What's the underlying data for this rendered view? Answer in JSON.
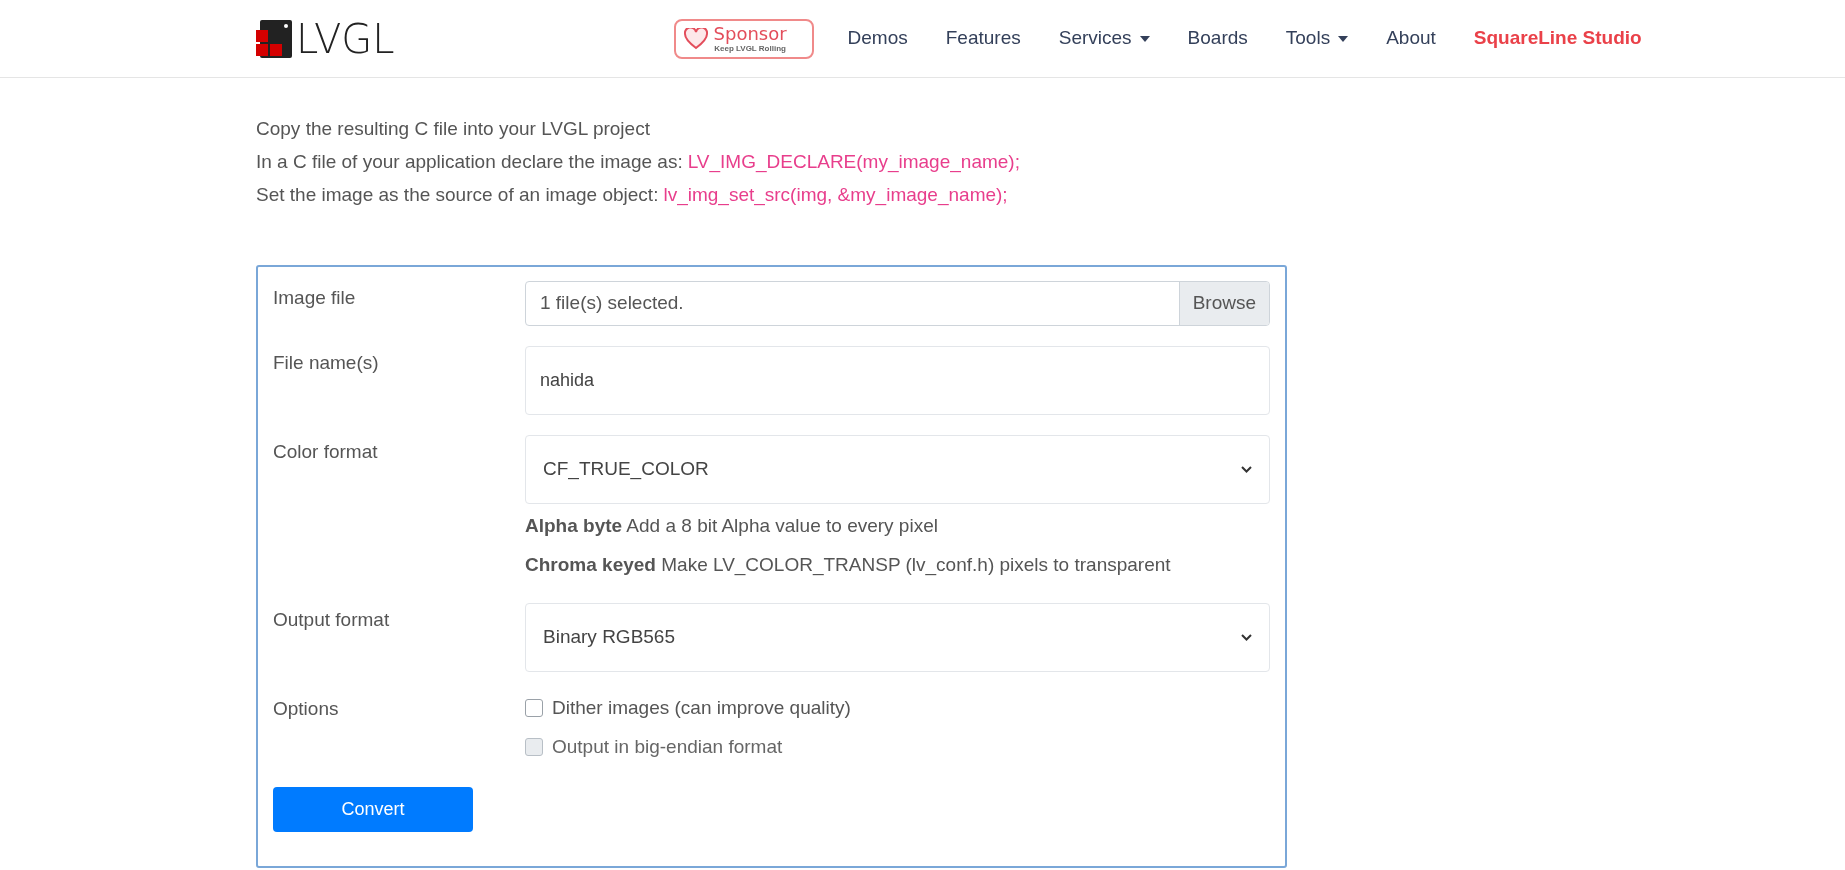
{
  "header": {
    "logo": "LVGL",
    "sponsor": {
      "title": "Sponsor",
      "subtitle": "Keep LVGL Rolling"
    },
    "nav": [
      {
        "label": "Demos",
        "dropdown": false,
        "highlight": false
      },
      {
        "label": "Features",
        "dropdown": false,
        "highlight": false
      },
      {
        "label": "Services",
        "dropdown": true,
        "highlight": false
      },
      {
        "label": "Boards",
        "dropdown": false,
        "highlight": false
      },
      {
        "label": "Tools",
        "dropdown": true,
        "highlight": false
      },
      {
        "label": "About",
        "dropdown": false,
        "highlight": false
      },
      {
        "label": "SquareLine Studio",
        "dropdown": false,
        "highlight": true
      }
    ]
  },
  "instructions": [
    {
      "text": "Copy the resulting C file into your LVGL project"
    },
    {
      "text": "In a C file of your application declare the image as:",
      "code": "LV_IMG_DECLARE(my_image_name);"
    },
    {
      "text": "Set the image as the source of an image object:",
      "code": "lv_img_set_src(img, &my_image_name);"
    }
  ],
  "form": {
    "rows": [
      {
        "kind": "file",
        "label": "Image file",
        "value": "1 file(s) selected.",
        "button": "Browse"
      },
      {
        "kind": "text",
        "label": "File name(s)",
        "value": "nahida"
      },
      {
        "kind": "select",
        "label": "Color format",
        "value": "CF_TRUE_COLOR",
        "help": [
          "**Alpha byte** Add a 8 bit Alpha value to every pixel",
          "**Chroma keyed** Make LV_COLOR_TRANSP (lv_conf.h) pixels to transparent"
        ]
      },
      {
        "kind": "select",
        "label": "Output format",
        "value": "Binary RGB565"
      },
      {
        "kind": "checks",
        "label": "Options",
        "options": [
          {
            "label": "Dither images (can improve quality)",
            "checked": false,
            "disabled": false
          },
          {
            "label": "Output in big-endian format",
            "checked": false,
            "disabled": true
          }
        ]
      }
    ],
    "submit": "Convert"
  }
}
